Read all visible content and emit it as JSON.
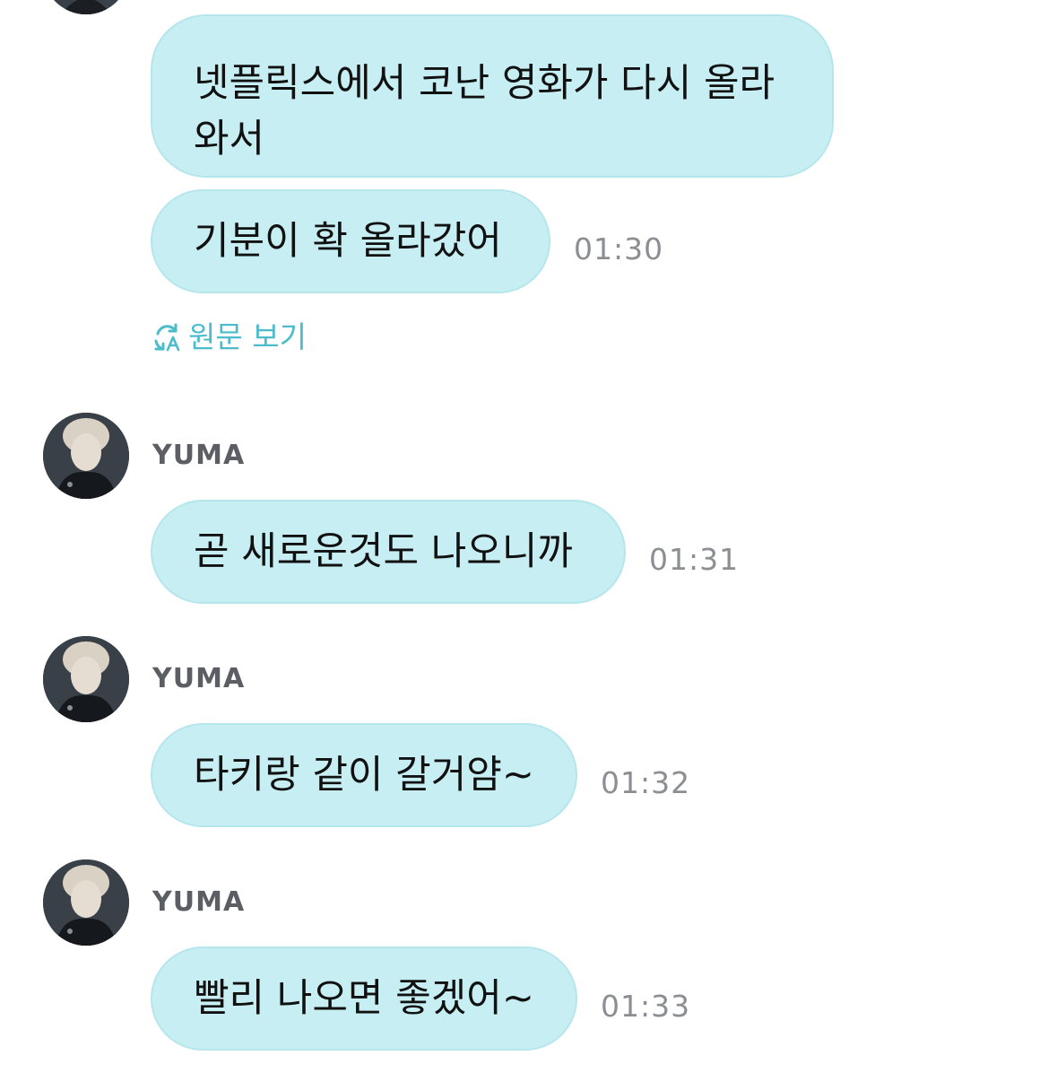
{
  "colors": {
    "bubble_bg": "#c7eff3",
    "accent": "#4cbccb",
    "timestamp": "#8b8e92",
    "sender": "#5b5f63"
  },
  "messages": [
    {
      "text": "넷플릭스에서 코난 영화가 다시 올라와서"
    },
    {
      "text": "기분이 확 올라갔어",
      "time": "01:30"
    },
    {
      "sender": "YUMA",
      "avatar_icon": "profile-photo",
      "text": "곧 새로운것도 나오니까",
      "time": "01:31"
    },
    {
      "sender": "YUMA",
      "avatar_icon": "profile-photo",
      "text": "타키랑 같이 갈거얌~",
      "time": "01:32"
    },
    {
      "sender": "YUMA",
      "avatar_icon": "profile-photo",
      "text": "빨리 나오면 좋겠어~",
      "time": "01:33"
    }
  ],
  "translate_toggle": {
    "icon": "translate-icon",
    "label": "원문 보기"
  }
}
